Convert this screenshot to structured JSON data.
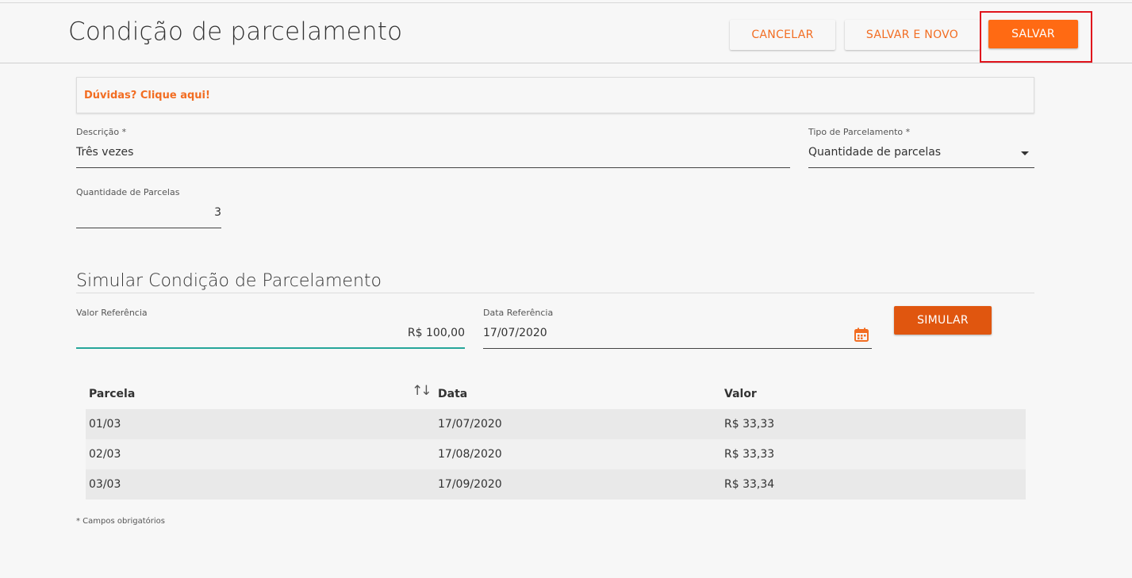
{
  "header": {
    "title": "Condição de parcelamento",
    "cancel_label": "CANCELAR",
    "save_new_label": "SALVAR E NOVO",
    "save_label": "SALVAR"
  },
  "help": {
    "link_text": "Dúvidas? Clique aqui!"
  },
  "form": {
    "descricao_label": "Descrição *",
    "descricao_value": "Três vezes",
    "tipo_label": "Tipo de Parcelamento *",
    "tipo_value": "Quantidade de parcelas",
    "quantidade_label": "Quantidade de Parcelas",
    "quantidade_value": "3"
  },
  "simulation": {
    "title": "Simular Condição de Parcelamento",
    "valor_label": "Valor Referência",
    "valor_value": "R$ 100,00",
    "data_label": "Data Referência",
    "data_value": "17/07/2020",
    "simulate_label": "SIMULAR"
  },
  "table": {
    "headers": [
      "Parcela",
      "Data",
      "Valor"
    ],
    "rows": [
      [
        "01/03",
        "17/07/2020",
        "R$ 33,33"
      ],
      [
        "02/03",
        "17/08/2020",
        "R$ 33,33"
      ],
      [
        "03/03",
        "17/09/2020",
        "R$ 33,34"
      ]
    ]
  },
  "footnote": "* Campos obrigatórios",
  "colors": {
    "accent": "#ff6a13",
    "accent_dark": "#e0560f",
    "focus_underline": "#26a69a",
    "highlight_border": "#e0141c"
  },
  "icons": {
    "calendar": "calendar-icon",
    "sort": "sort-icon",
    "dropdown": "chevron-down-icon"
  }
}
